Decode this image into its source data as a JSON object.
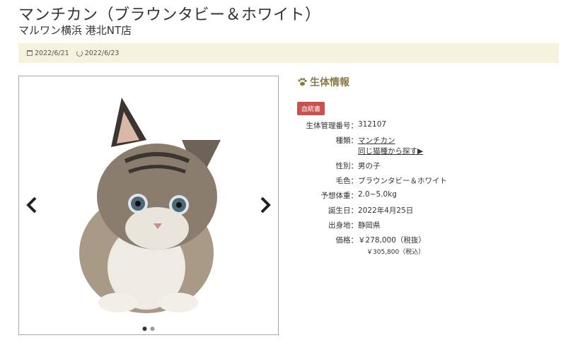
{
  "page": {
    "title": "マンチカン（ブラウンタビー＆ホワイト）",
    "store": "マルワン横浜 港北NT店"
  },
  "dates": {
    "posted": "2022/6/21",
    "updated": "2022/6/23"
  },
  "carousel": {
    "image_alt": "kitten-photo",
    "slide_count": 2,
    "active_index": 0
  },
  "info": {
    "section_title": "生体情報",
    "badge": "血統書",
    "id_label": "生体管理番号：",
    "id_value": "312107",
    "breed_label": "種類：",
    "breed_value": "マンチカン",
    "breed_link": "同じ猫種から探す▶",
    "sex_label": "性別：",
    "sex_value": "男の子",
    "color_label": "毛色：",
    "color_value": "ブラウンタビー＆ホワイト",
    "weight_label": "予想体重：",
    "weight_value": "2.0~5.0kg",
    "birth_label": "誕生日：",
    "birth_value": "2022年4月25日",
    "origin_label": "出身地：",
    "origin_value": "静岡県",
    "price_label": "価格：",
    "price_excl": "￥278,000（税抜）",
    "price_incl": "￥305,800（税込）"
  },
  "colors": {
    "datebar_bg": "#f5f1dc",
    "section_title": "#8a7a4a",
    "badge_bg": "#c9524f"
  }
}
